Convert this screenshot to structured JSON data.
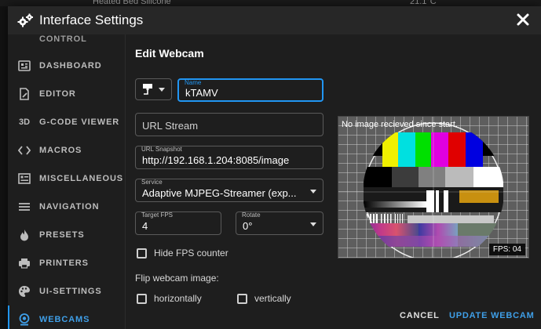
{
  "background": {
    "partial_text": "Heated Bed Silicone",
    "partial_value": "21.1°C"
  },
  "dialog": {
    "title": "Interface Settings",
    "close_icon": "close-icon"
  },
  "sidebar": {
    "top_partial": "CONTROL",
    "items": [
      {
        "label": "DASHBOARD",
        "icon": "dashboard-icon"
      },
      {
        "label": "EDITOR",
        "icon": "editor-icon"
      },
      {
        "label": "G-CODE VIEWER",
        "icon": "3d-icon",
        "icon_text": "3D"
      },
      {
        "label": "MACROS",
        "icon": "code-icon"
      },
      {
        "label": "MISCELLANEOUS",
        "icon": "miscellaneous-icon"
      },
      {
        "label": "NAVIGATION",
        "icon": "menu-icon"
      },
      {
        "label": "PRESETS",
        "icon": "fire-icon"
      },
      {
        "label": "PRINTERS",
        "icon": "printer-icon"
      },
      {
        "label": "UI-SETTINGS",
        "icon": "palette-icon"
      },
      {
        "label": "WEBCAMS",
        "icon": "webcam-icon",
        "active": true
      }
    ],
    "active_color": "#2196f3"
  },
  "form": {
    "title": "Edit Webcam",
    "icon_select": {
      "icon": "webcam-mount-icon"
    },
    "name": {
      "label": "Name",
      "value": "kTAMV"
    },
    "url_stream": {
      "placeholder": "URL Stream",
      "value": ""
    },
    "url_snapshot": {
      "label": "URL Snapshot",
      "value": "http://192.168.1.204:8085/image"
    },
    "service": {
      "label": "Service",
      "value": "Adaptive MJPEG-Streamer (exp..."
    },
    "target_fps": {
      "label": "Target FPS",
      "value": "4"
    },
    "rotate": {
      "label": "Rotate",
      "value": "0°"
    },
    "hide_fps": {
      "label": "Hide FPS counter",
      "checked": false
    },
    "flip": {
      "label": "Flip webcam image:",
      "horizontally": {
        "label": "horizontally",
        "checked": false
      },
      "vertically": {
        "label": "vertically",
        "checked": false
      }
    }
  },
  "preview": {
    "message": "No image recieved since start.",
    "fps_badge": "FPS: 04"
  },
  "actions": {
    "cancel": "CANCEL",
    "update": "UPDATE WEBCAM"
  }
}
